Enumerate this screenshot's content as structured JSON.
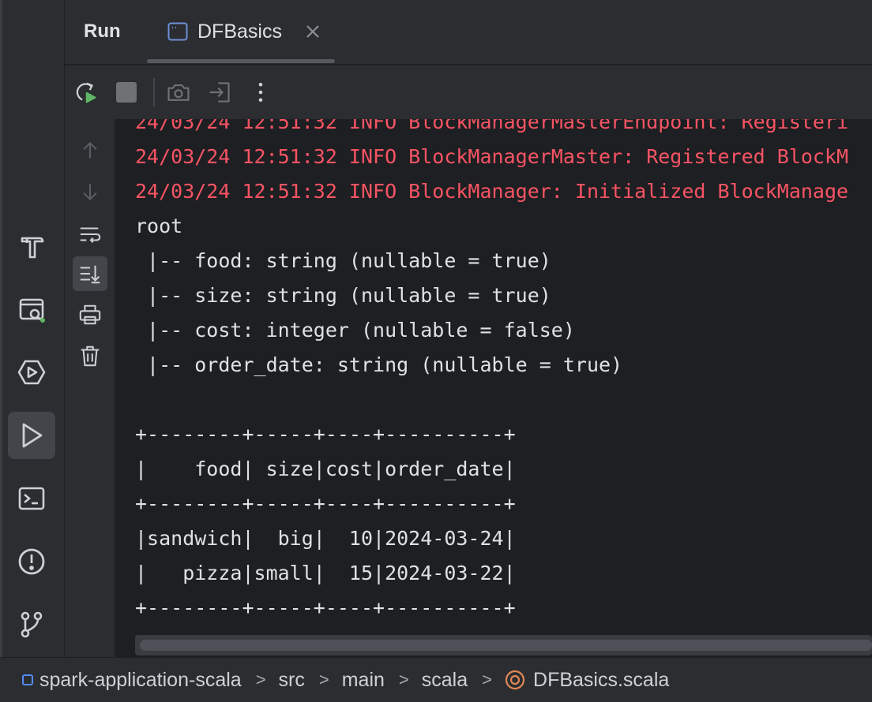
{
  "header": {
    "run_title": "Run",
    "tab_label": "DFBasics"
  },
  "left_strip": {
    "items": [
      "build-icon",
      "services-icon",
      "debug-icon",
      "run-icon",
      "terminal-icon",
      "problems-icon",
      "git-icon"
    ],
    "active": "run-icon"
  },
  "toolbar": {
    "items": [
      "rerun-icon",
      "stop-icon",
      "screenshot-icon",
      "attach-icon",
      "more-icon"
    ]
  },
  "console_side": {
    "items": [
      "up-arrow-icon",
      "down-arrow-icon",
      "soft-wrap-icon",
      "scroll-to-end-icon",
      "print-icon",
      "clear-icon"
    ],
    "active": "scroll-to-end-icon"
  },
  "console": {
    "lines": [
      "24/03/24 12:51:32 INFO BlockManagerMasterEndpoint: Registeri",
      "24/03/24 12:51:32 INFO BlockManagerMaster: Registered BlockM",
      "24/03/24 12:51:32 INFO BlockManager: Initialized BlockManage",
      "root",
      " |-- food: string (nullable = true)",
      " |-- size: string (nullable = true)",
      " |-- cost: integer (nullable = false)",
      " |-- order_date: string (nullable = true)",
      "",
      "+--------+-----+----+----------+",
      "|    food| size|cost|order_date|",
      "+--------+-----+----+----------+",
      "|sandwich|  big|  10|2024-03-24|",
      "|   pizza|small|  15|2024-03-22|",
      "+--------+-----+----+----------+"
    ],
    "error_line_count": 3
  },
  "statusbar": {
    "crumbs": [
      "spark-application-scala",
      "src",
      "main",
      "scala",
      "DFBasics.scala"
    ]
  },
  "colors": {
    "error": "#f75464",
    "accent": "#548af7",
    "scala": "#e08855"
  }
}
